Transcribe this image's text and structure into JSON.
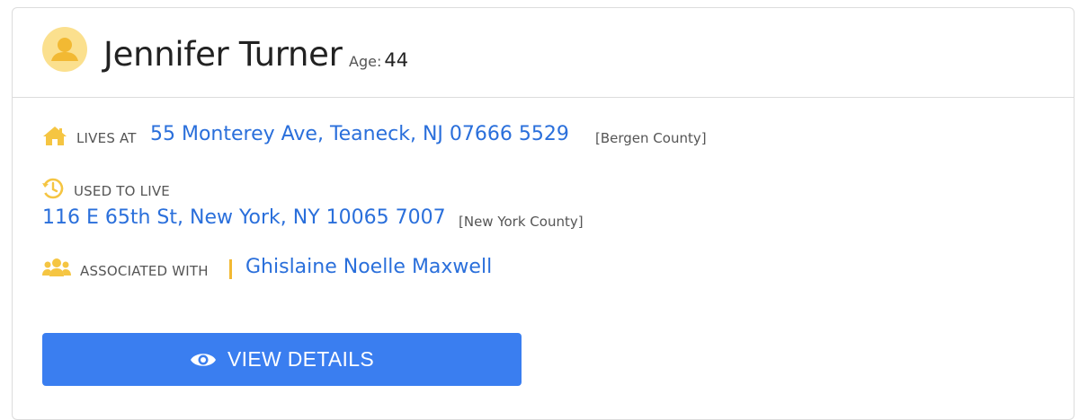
{
  "person": {
    "name": "Jennifer Turner",
    "age_label": "Age:",
    "age_value": "44"
  },
  "lives_at": {
    "label": "LIVES AT",
    "address": "55 Monterey Ave, Teaneck, NJ 07666 5529",
    "county": "[Bergen County]"
  },
  "used_to_live": {
    "label": "USED TO LIVE",
    "address": "116 E 65th St, New York, NY 10065 7007",
    "county": "[New York County]"
  },
  "associated": {
    "label": "ASSOCIATED WITH",
    "name": "Ghislaine Noelle Maxwell"
  },
  "button": {
    "label": "VIEW DETAILS",
    "icon": "eye-icon"
  },
  "colors": {
    "accent_blue": "#3a7ef0",
    "link_blue": "#2a6fdb",
    "icon_yellow": "#f5c542"
  }
}
